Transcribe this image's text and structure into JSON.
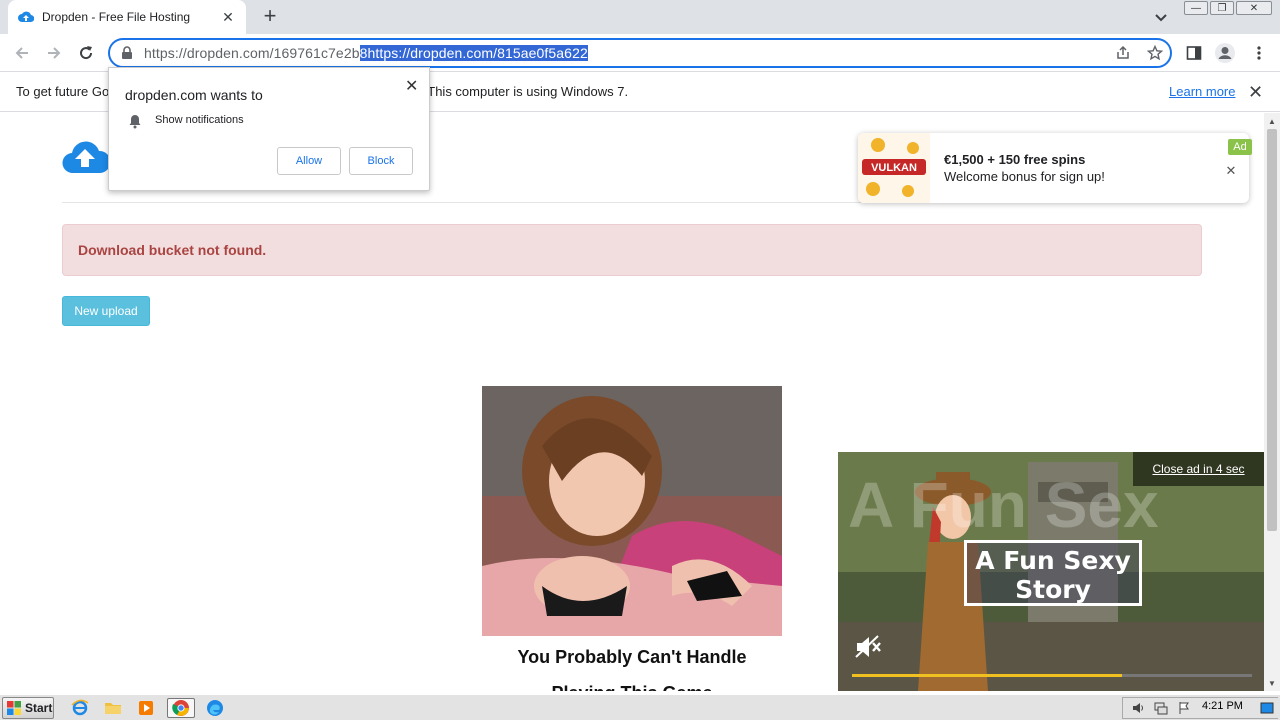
{
  "browser": {
    "tab": {
      "title": "Dropden - Free File Hosting"
    },
    "url": {
      "prefix": "https://dropden.com/169761c7e2b",
      "selected": "8https://dropden.com/815ae0f5a622"
    },
    "infobar": {
      "message": "To get future Google Chrome updates, you'll need Windows 10 or later. This computer is using Windows 7.",
      "link": "Learn more"
    }
  },
  "permission_popup": {
    "heading": "dropden.com wants to",
    "option": "Show notifications",
    "allow": "Allow",
    "block": "Block"
  },
  "page": {
    "alert": "Download bucket not found.",
    "new_upload": "New upload",
    "ad_caption_line1": "You Probably Can't Handle",
    "ad_caption_line2": "Playing This Game"
  },
  "casino_ad": {
    "line1": "€1,500 + 150 free spins",
    "line2": "Welcome bonus for sign up!",
    "badge": "Ad",
    "logo_text": "VULKAN"
  },
  "video_ad": {
    "close_text": "Close ad in 4 sec",
    "title": "A Fun Sexy Story",
    "progress": 0.675
  },
  "taskbar": {
    "start": "Start",
    "clock": "4:21 PM"
  },
  "colors": {
    "accent": "#1a73e8",
    "alert_bg": "#f2dede",
    "alert_text": "#a94442",
    "button": "#5bc0de"
  }
}
